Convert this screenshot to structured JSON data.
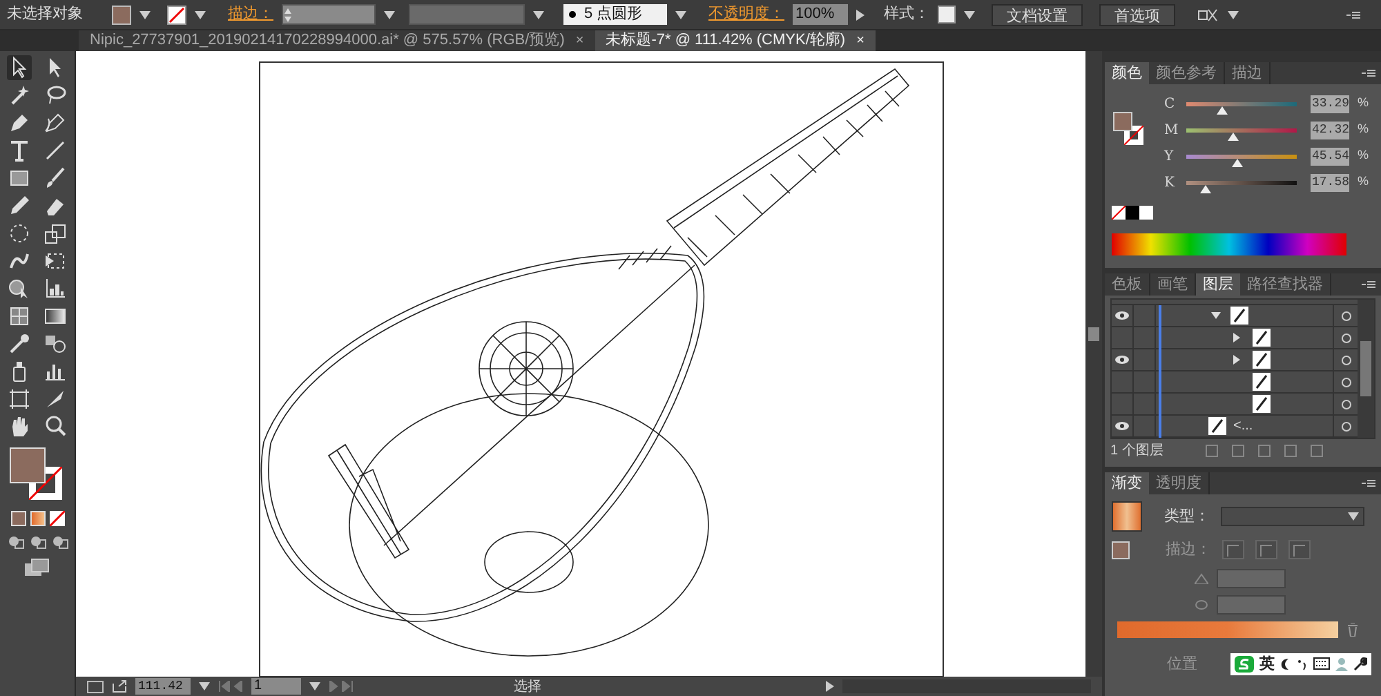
{
  "control_bar": {
    "selection": "未选择对象",
    "stroke_label": "描边：",
    "brush": "5 点圆形",
    "opacity_label": "不透明度：",
    "opacity": "100%",
    "style_label": "样式：",
    "buttons": [
      "文档设置",
      "首选项"
    ]
  },
  "tabs": [
    {
      "label": "Nipic_27737901_20190214170228994000.ai* @ 575.57% (RGB/预览)",
      "close": "×",
      "selected": false
    },
    {
      "label": "未标题-7* @ 111.42% (CMYK/轮廓)",
      "close": "×",
      "selected": true
    }
  ],
  "color_panel": {
    "tabs": [
      {
        "label": "颜色",
        "selected": true
      },
      {
        "label": "颜色参考",
        "selected": false
      },
      {
        "label": "描边",
        "selected": false
      }
    ],
    "sliders": [
      {
        "label": "C",
        "value": "33.29",
        "unit": "%",
        "level": 0.33
      },
      {
        "label": "M",
        "value": "42.32",
        "unit": "%",
        "level": 0.42
      },
      {
        "label": "Y",
        "value": "45.54",
        "unit": "%",
        "level": 0.46
      },
      {
        "label": "K",
        "value": "17.58",
        "unit": "%",
        "level": 0.18
      }
    ]
  },
  "layers_panel": {
    "tabs": [
      {
        "label": "色板",
        "selected": false
      },
      {
        "label": "画笔",
        "selected": false
      },
      {
        "label": "图层",
        "selected": true
      },
      {
        "label": "路径查找器",
        "selected": false
      }
    ],
    "rows": [
      {
        "visible": true,
        "expanded": true,
        "children": [
          {
            "visible": false,
            "expanded": false
          },
          {
            "visible": true,
            "expanded": false
          },
          {
            "visible": false
          },
          {
            "visible": false
          }
        ]
      },
      {
        "visible": true,
        "label": "<..."
      }
    ],
    "footer": "1 个图层"
  },
  "gradient_panel": {
    "tabs": [
      {
        "label": "渐变",
        "selected": true
      },
      {
        "label": "透明度",
        "selected": false
      }
    ],
    "type_label": "类型：",
    "stroke_label": "描边：",
    "position_label": "位置"
  },
  "status_bar": {
    "zoom": "111.42",
    "page": "1",
    "tool": "选择"
  },
  "ime_bar": {
    "language": "英"
  }
}
